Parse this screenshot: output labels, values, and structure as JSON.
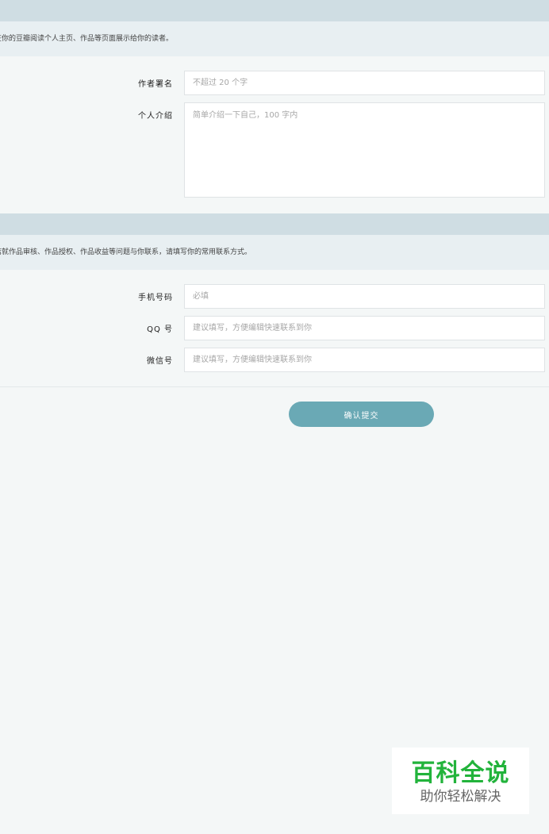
{
  "profile_section": {
    "note": "在你的豆瓣阅读个人主页、作品等页面展示给你的读者。",
    "fields": {
      "pen_name": {
        "label": "作者署名",
        "placeholder": "不超过 20 个字",
        "value": ""
      },
      "bio": {
        "label": "个人介绍",
        "placeholder": "简单介绍一下自己，100 字内",
        "value": ""
      }
    }
  },
  "contact_section": {
    "note": "若就作品审核、作品授权、作品收益等问题与你联系，请填写你的常用联系方式。",
    "fields": {
      "phone": {
        "label": "手机号码",
        "placeholder": "必填",
        "value": ""
      },
      "qq": {
        "label": "QQ 号",
        "placeholder": "建议填写，方便编辑快速联系到你",
        "value": ""
      },
      "wechat": {
        "label": "微信号",
        "placeholder": "建议填写，方便编辑快速联系到你",
        "value": ""
      }
    }
  },
  "actions": {
    "submit_label": "确认提交"
  },
  "watermark": {
    "title": "百科全说",
    "subtitle": "助你轻松解决"
  },
  "colors": {
    "page_bg": "#f4f7f7",
    "section_header_bg": "#cfdde3",
    "section_note_bg": "#e8eff2",
    "accent": "#6aa9b5",
    "watermark_green": "#22b33b"
  }
}
